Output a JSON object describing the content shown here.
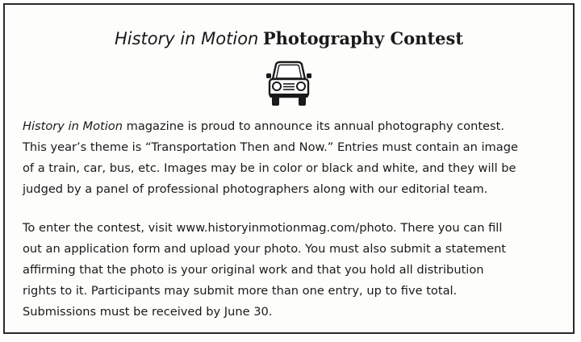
{
  "notice": {
    "title_italic": "History in Motion",
    "title_bold": "Photography Contest",
    "icon": "car-front-icon",
    "paragraph1": {
      "magazine_name": "History in Motion",
      "line1_rest": " magazine is proud to announce its annual photography contest.",
      "line2": "This year’s theme is “Transportation Then and Now.” Entries must contain an image",
      "line3": "of a train, car, bus, etc. Images may be in color or black and white, and they will be",
      "line4": "judged by a panel of professional photographers along with our editorial team."
    },
    "paragraph2": {
      "lines": [
        "To enter the contest, visit www.historyinmotionmag.com/photo. There you can fill",
        "out an application form and upload your photo. You must also submit a statement",
        "affirming that the photo is your original work and that you hold all distribution",
        "rights to it. Participants may submit more than one entry, up to five total.",
        "Submissions must be received by June 30."
      ]
    }
  }
}
